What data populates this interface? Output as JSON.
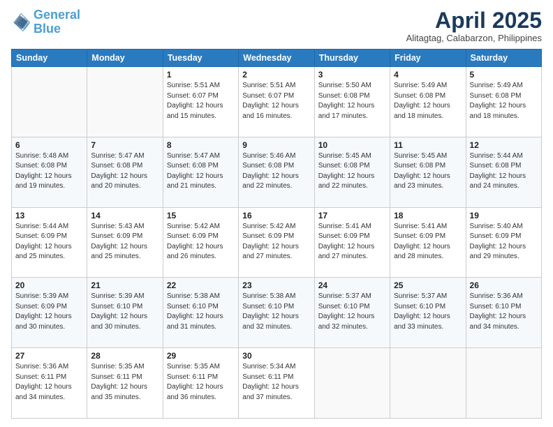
{
  "logo": {
    "line1": "General",
    "line2": "Blue"
  },
  "title": "April 2025",
  "subtitle": "Alitagtag, Calabarzon, Philippines",
  "days_of_week": [
    "Sunday",
    "Monday",
    "Tuesday",
    "Wednesday",
    "Thursday",
    "Friday",
    "Saturday"
  ],
  "weeks": [
    [
      {
        "day": "",
        "info": ""
      },
      {
        "day": "",
        "info": ""
      },
      {
        "day": "1",
        "info": "Sunrise: 5:51 AM\nSunset: 6:07 PM\nDaylight: 12 hours\nand 15 minutes."
      },
      {
        "day": "2",
        "info": "Sunrise: 5:51 AM\nSunset: 6:07 PM\nDaylight: 12 hours\nand 16 minutes."
      },
      {
        "day": "3",
        "info": "Sunrise: 5:50 AM\nSunset: 6:08 PM\nDaylight: 12 hours\nand 17 minutes."
      },
      {
        "day": "4",
        "info": "Sunrise: 5:49 AM\nSunset: 6:08 PM\nDaylight: 12 hours\nand 18 minutes."
      },
      {
        "day": "5",
        "info": "Sunrise: 5:49 AM\nSunset: 6:08 PM\nDaylight: 12 hours\nand 18 minutes."
      }
    ],
    [
      {
        "day": "6",
        "info": "Sunrise: 5:48 AM\nSunset: 6:08 PM\nDaylight: 12 hours\nand 19 minutes."
      },
      {
        "day": "7",
        "info": "Sunrise: 5:47 AM\nSunset: 6:08 PM\nDaylight: 12 hours\nand 20 minutes."
      },
      {
        "day": "8",
        "info": "Sunrise: 5:47 AM\nSunset: 6:08 PM\nDaylight: 12 hours\nand 21 minutes."
      },
      {
        "day": "9",
        "info": "Sunrise: 5:46 AM\nSunset: 6:08 PM\nDaylight: 12 hours\nand 22 minutes."
      },
      {
        "day": "10",
        "info": "Sunrise: 5:45 AM\nSunset: 6:08 PM\nDaylight: 12 hours\nand 22 minutes."
      },
      {
        "day": "11",
        "info": "Sunrise: 5:45 AM\nSunset: 6:08 PM\nDaylight: 12 hours\nand 23 minutes."
      },
      {
        "day": "12",
        "info": "Sunrise: 5:44 AM\nSunset: 6:08 PM\nDaylight: 12 hours\nand 24 minutes."
      }
    ],
    [
      {
        "day": "13",
        "info": "Sunrise: 5:44 AM\nSunset: 6:09 PM\nDaylight: 12 hours\nand 25 minutes."
      },
      {
        "day": "14",
        "info": "Sunrise: 5:43 AM\nSunset: 6:09 PM\nDaylight: 12 hours\nand 25 minutes."
      },
      {
        "day": "15",
        "info": "Sunrise: 5:42 AM\nSunset: 6:09 PM\nDaylight: 12 hours\nand 26 minutes."
      },
      {
        "day": "16",
        "info": "Sunrise: 5:42 AM\nSunset: 6:09 PM\nDaylight: 12 hours\nand 27 minutes."
      },
      {
        "day": "17",
        "info": "Sunrise: 5:41 AM\nSunset: 6:09 PM\nDaylight: 12 hours\nand 27 minutes."
      },
      {
        "day": "18",
        "info": "Sunrise: 5:41 AM\nSunset: 6:09 PM\nDaylight: 12 hours\nand 28 minutes."
      },
      {
        "day": "19",
        "info": "Sunrise: 5:40 AM\nSunset: 6:09 PM\nDaylight: 12 hours\nand 29 minutes."
      }
    ],
    [
      {
        "day": "20",
        "info": "Sunrise: 5:39 AM\nSunset: 6:09 PM\nDaylight: 12 hours\nand 30 minutes."
      },
      {
        "day": "21",
        "info": "Sunrise: 5:39 AM\nSunset: 6:10 PM\nDaylight: 12 hours\nand 30 minutes."
      },
      {
        "day": "22",
        "info": "Sunrise: 5:38 AM\nSunset: 6:10 PM\nDaylight: 12 hours\nand 31 minutes."
      },
      {
        "day": "23",
        "info": "Sunrise: 5:38 AM\nSunset: 6:10 PM\nDaylight: 12 hours\nand 32 minutes."
      },
      {
        "day": "24",
        "info": "Sunrise: 5:37 AM\nSunset: 6:10 PM\nDaylight: 12 hours\nand 32 minutes."
      },
      {
        "day": "25",
        "info": "Sunrise: 5:37 AM\nSunset: 6:10 PM\nDaylight: 12 hours\nand 33 minutes."
      },
      {
        "day": "26",
        "info": "Sunrise: 5:36 AM\nSunset: 6:10 PM\nDaylight: 12 hours\nand 34 minutes."
      }
    ],
    [
      {
        "day": "27",
        "info": "Sunrise: 5:36 AM\nSunset: 6:11 PM\nDaylight: 12 hours\nand 34 minutes."
      },
      {
        "day": "28",
        "info": "Sunrise: 5:35 AM\nSunset: 6:11 PM\nDaylight: 12 hours\nand 35 minutes."
      },
      {
        "day": "29",
        "info": "Sunrise: 5:35 AM\nSunset: 6:11 PM\nDaylight: 12 hours\nand 36 minutes."
      },
      {
        "day": "30",
        "info": "Sunrise: 5:34 AM\nSunset: 6:11 PM\nDaylight: 12 hours\nand 37 minutes."
      },
      {
        "day": "",
        "info": ""
      },
      {
        "day": "",
        "info": ""
      },
      {
        "day": "",
        "info": ""
      }
    ]
  ]
}
